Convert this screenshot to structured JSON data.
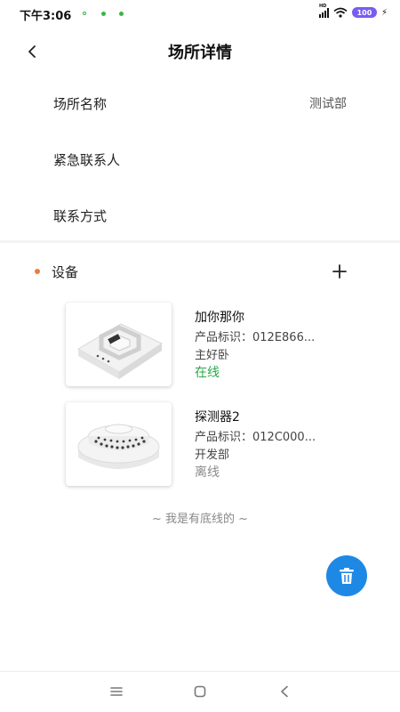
{
  "status_bar": {
    "time": "下午3:06",
    "network_tag": "HD",
    "battery": "100",
    "dot_color": "#3cb44b"
  },
  "header": {
    "title": "场所详情",
    "back_icon": "chevron-left-icon"
  },
  "info": [
    {
      "label": "场所名称",
      "value": "测试部"
    },
    {
      "label": "紧急联系人",
      "value": ""
    },
    {
      "label": "联系方式",
      "value": ""
    }
  ],
  "devices_section": {
    "title": "设备",
    "accent_color": "#f07a3a",
    "add_icon": "plus-icon"
  },
  "devices": [
    {
      "name": "加你那你",
      "id_text": "产品标识：012E866...",
      "room": "主好卧",
      "status": "在线",
      "status_color": "#2aa74a",
      "image": "square-detector-image"
    },
    {
      "name": "探测器2",
      "id_text": "产品标识：012C000...",
      "room": "开发部",
      "status": "离线",
      "status_color": "#8a8a8a",
      "image": "round-smoke-detector-image"
    }
  ],
  "footer_note": "~ 我是有底线的 ~",
  "fab": {
    "icon": "trash-icon",
    "color": "#1e88e5"
  },
  "nav": {
    "menu_icon": "menu-icon",
    "home_icon": "home-square-icon",
    "back_icon": "back-triangle-icon"
  }
}
